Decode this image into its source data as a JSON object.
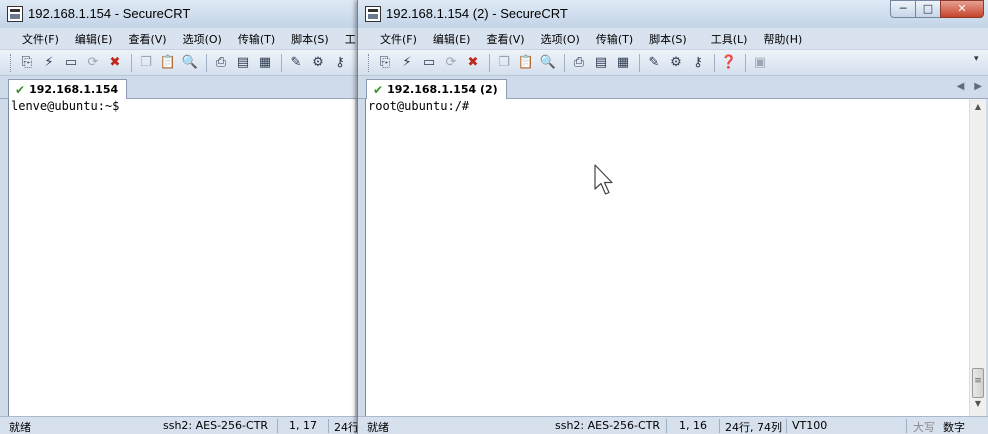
{
  "windowA": {
    "title": "192.168.1.154 - SecureCRT",
    "menus": [
      "文件(F)",
      "编辑(E)",
      "查看(V)",
      "选项(O)",
      "传输(T)",
      "脚本(S)",
      "工"
    ],
    "tab_label": "192.168.1.154",
    "prompt": "lenve@ubuntu:~$",
    "status": {
      "ready": "就绪",
      "cipher": "ssh2: AES-256-CTR",
      "cursor": "1, 17",
      "size": "24行"
    }
  },
  "windowB": {
    "title": "192.168.1.154 (2) - SecureCRT",
    "menus": [
      "文件(F)",
      "编辑(E)",
      "查看(V)",
      "选项(O)",
      "传输(T)",
      "脚本(S)",
      "工具(L)",
      "帮助(H)"
    ],
    "tab_label": "192.168.1.154 (2)",
    "prompt": "root@ubuntu:/#",
    "status": {
      "ready": "就绪",
      "cipher": "ssh2: AES-256-CTR",
      "cursor": "1, 16",
      "size": "24行, 74列",
      "term": "VT100",
      "caps": "大写",
      "num": "数字"
    }
  },
  "toolbar_icons": [
    "connect-icon",
    "quick-connect-icon",
    "connect-in-tab-icon",
    "reconnect-icon",
    "disconnect-icon",
    "copy-icon",
    "paste-icon",
    "find-icon",
    "print-icon",
    "print-selection-icon",
    "print-setup-icon",
    "session-options-icon",
    "global-options-icon",
    "keymap-icon",
    "help-icon",
    "lock-icon"
  ],
  "caption_buttons": {
    "minimize": "─",
    "maximize": "□",
    "close": "✕"
  }
}
